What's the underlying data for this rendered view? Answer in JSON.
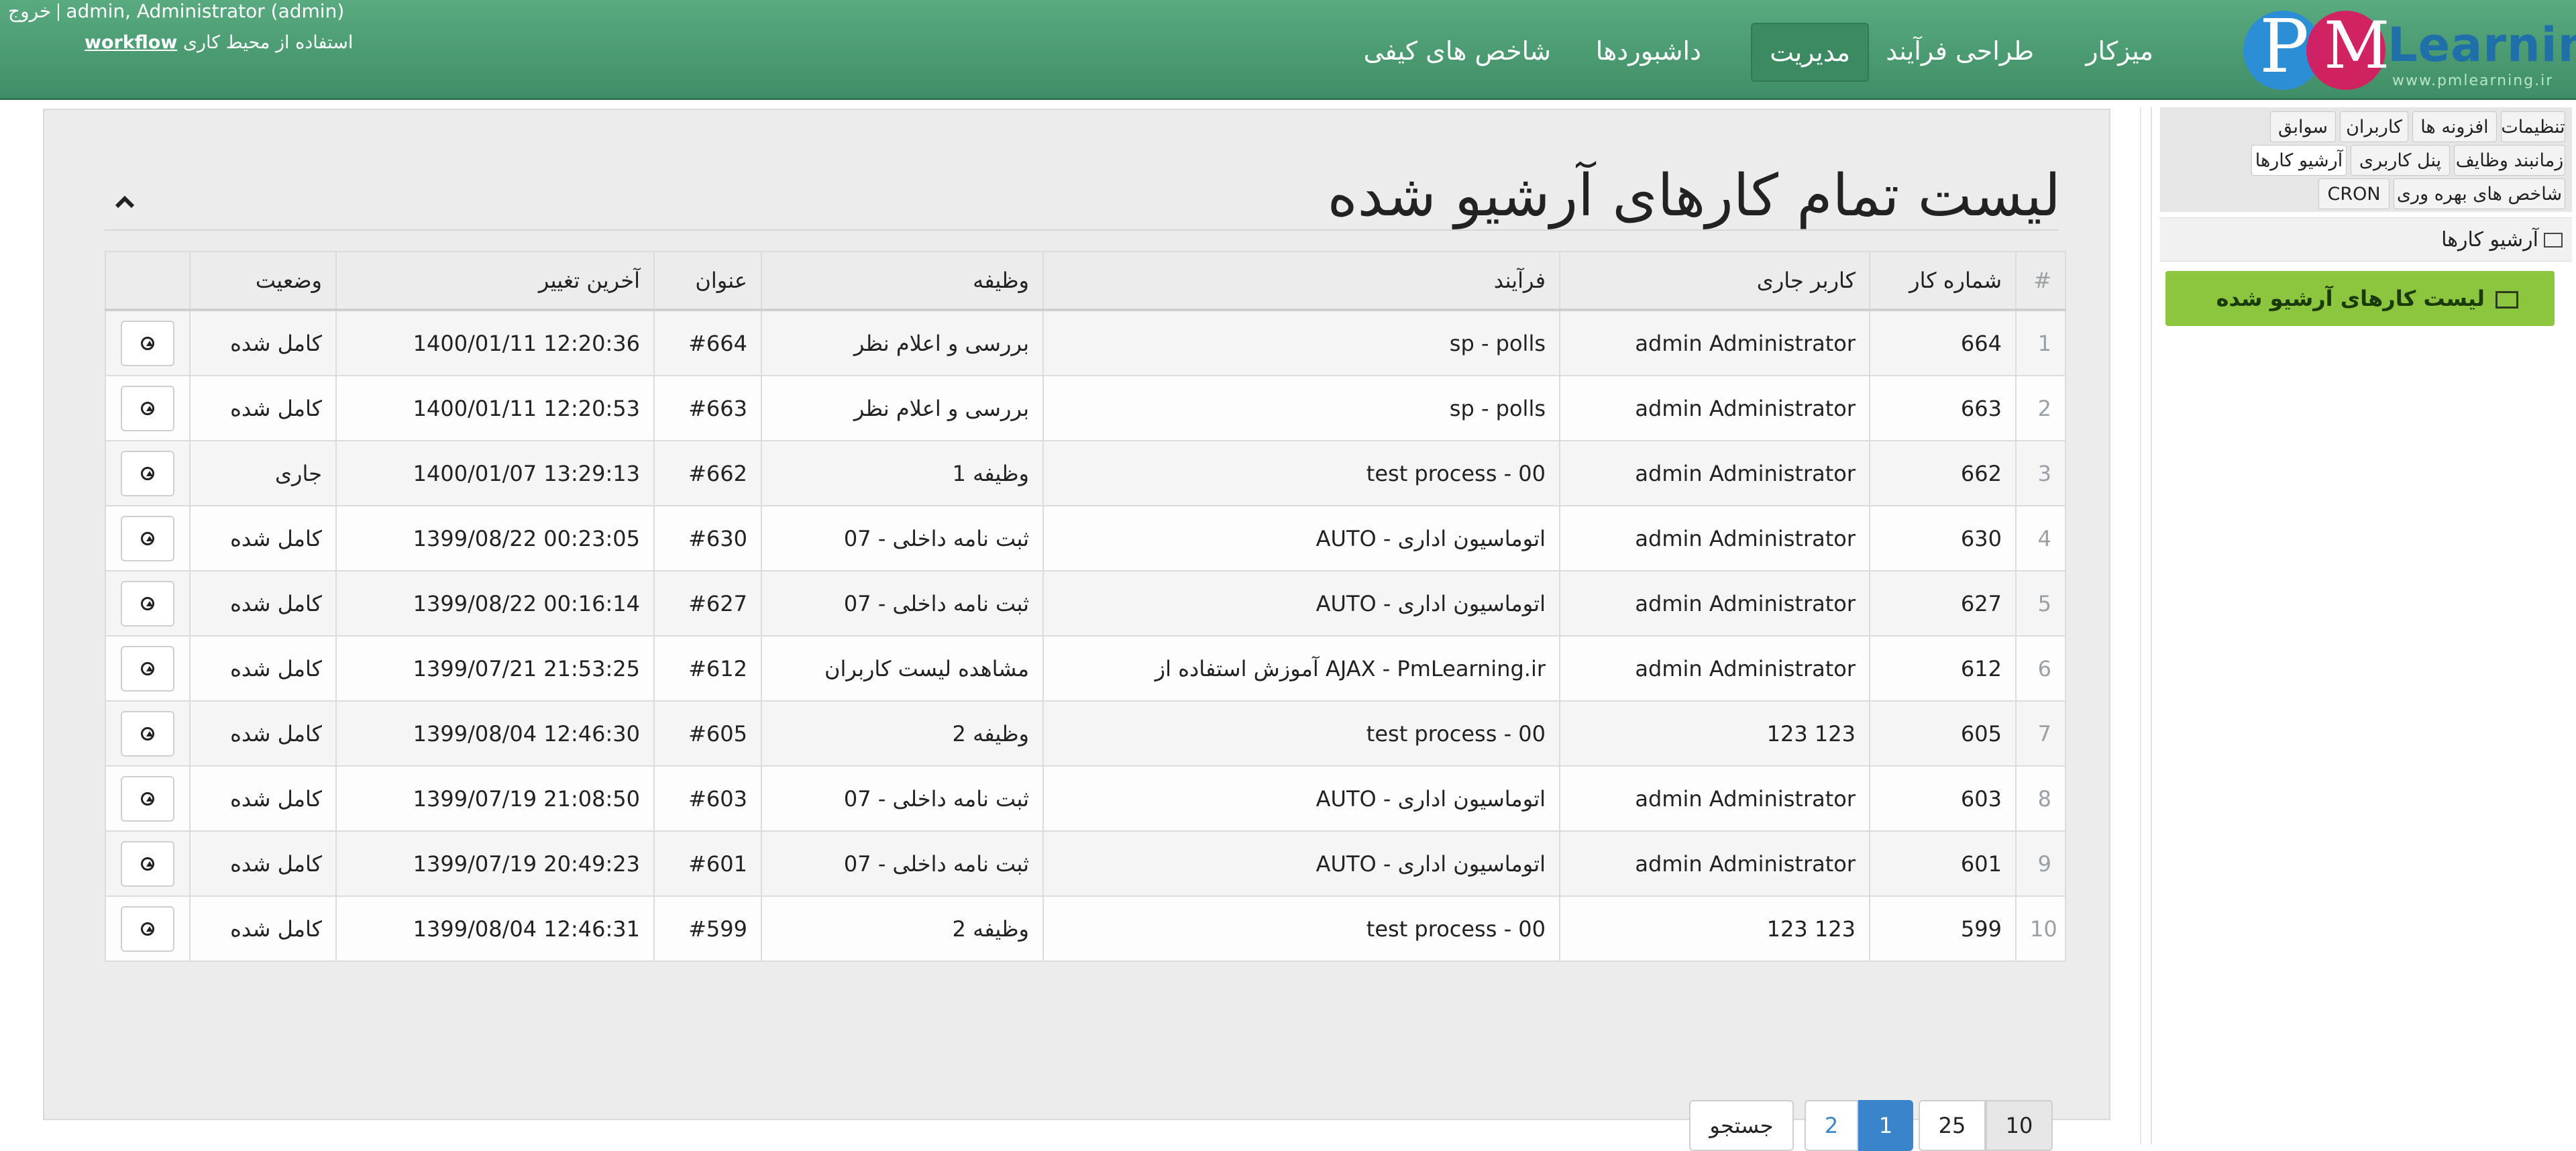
{
  "header": {
    "logo_letters": "PM",
    "logo_word": "Learning",
    "logo_sub": "www.pmlearning.ir",
    "nav": [
      "میزکار",
      "طراحی فرآیند",
      "مدیریت",
      "داشبوردها",
      "شاخص های کیفی"
    ],
    "logout": "خروج",
    "user": "admin, Administrator (admin)",
    "workspace_prefix": "استفاده از محیط کاری",
    "workspace_name": "workflow"
  },
  "sidebar": {
    "tabs": [
      "تنظیمات",
      "افزونه ها",
      "کاربران",
      "سوابق",
      "زمانبند وظایف",
      "پنل کاربری",
      "آرشیو کارها",
      "شاخص های بهره وری",
      "CRON"
    ],
    "active_tab": "آرشیو کارها",
    "section_title": "آرشیو کارها",
    "active_item": "لیست کارهای آرشیو شده"
  },
  "main": {
    "title": "لیست تمام کارهای آرشیو شده",
    "columns": {
      "index": "#",
      "case_no": "شماره کار",
      "current_user": "کاربر جاری",
      "process": "فرآیند",
      "task": "وظیفه",
      "subject": "عنوان",
      "last_change": "آخرین تغییر",
      "status": "وضعیت"
    },
    "rows": [
      {
        "index": "1",
        "case_no": "664",
        "current_user": "admin Administrator",
        "process": "sp - polls",
        "task": "بررسی و اعلام نظر",
        "subject": "#664",
        "last_change": "1400/01/11 12:20:36",
        "status": "کامل شده"
      },
      {
        "index": "2",
        "case_no": "663",
        "current_user": "admin Administrator",
        "process": "sp - polls",
        "task": "بررسی و اعلام نظر",
        "subject": "#663",
        "last_change": "1400/01/11 12:20:53",
        "status": "کامل شده"
      },
      {
        "index": "3",
        "case_no": "662",
        "current_user": "admin Administrator",
        "process": "test process - 00",
        "task": "وظیفه 1",
        "subject": "#662",
        "last_change": "1400/01/07 13:29:13",
        "status": "جاری"
      },
      {
        "index": "4",
        "case_no": "630",
        "current_user": "admin Administrator",
        "process": "AUTO - اتوماسیون اداری",
        "task": "07 - ثبت نامه داخلی",
        "subject": "#630",
        "last_change": "1399/08/22 00:23:05",
        "status": "کامل شده"
      },
      {
        "index": "5",
        "case_no": "627",
        "current_user": "admin Administrator",
        "process": "AUTO - اتوماسیون اداری",
        "task": "07 - ثبت نامه داخلی",
        "subject": "#627",
        "last_change": "1399/08/22 00:16:14",
        "status": "کامل شده"
      },
      {
        "index": "6",
        "case_no": "612",
        "current_user": "admin Administrator",
        "process": "آموزش استفاده از AJAX - PmLearning.ir",
        "task": "مشاهده لیست کاربران",
        "subject": "#612",
        "last_change": "1399/07/21 21:53:25",
        "status": "کامل شده"
      },
      {
        "index": "7",
        "case_no": "605",
        "current_user": "123 123",
        "process": "test process - 00",
        "task": "وظیفه 2",
        "subject": "#605",
        "last_change": "1399/08/04 12:46:30",
        "status": "کامل شده"
      },
      {
        "index": "8",
        "case_no": "603",
        "current_user": "admin Administrator",
        "process": "AUTO - اتوماسیون اداری",
        "task": "07 - ثبت نامه داخلی",
        "subject": "#603",
        "last_change": "1399/07/19 21:08:50",
        "status": "کامل شده"
      },
      {
        "index": "9",
        "case_no": "601",
        "current_user": "admin Administrator",
        "process": "AUTO - اتوماسیون اداری",
        "task": "07 - ثبت نامه داخلی",
        "subject": "#601",
        "last_change": "1399/07/19 20:49:23",
        "status": "کامل شده"
      },
      {
        "index": "10",
        "case_no": "599",
        "current_user": "123 123",
        "process": "test process - 00",
        "task": "وظیفه 2",
        "subject": "#599",
        "last_change": "1399/08/04 12:46:31",
        "status": "کامل شده"
      }
    ],
    "pagination": {
      "page_sizes": [
        "10",
        "25"
      ],
      "selected_page_size": "10",
      "pages": [
        "1",
        "2"
      ],
      "current_page": "1",
      "search_label": "جستجو"
    }
  }
}
